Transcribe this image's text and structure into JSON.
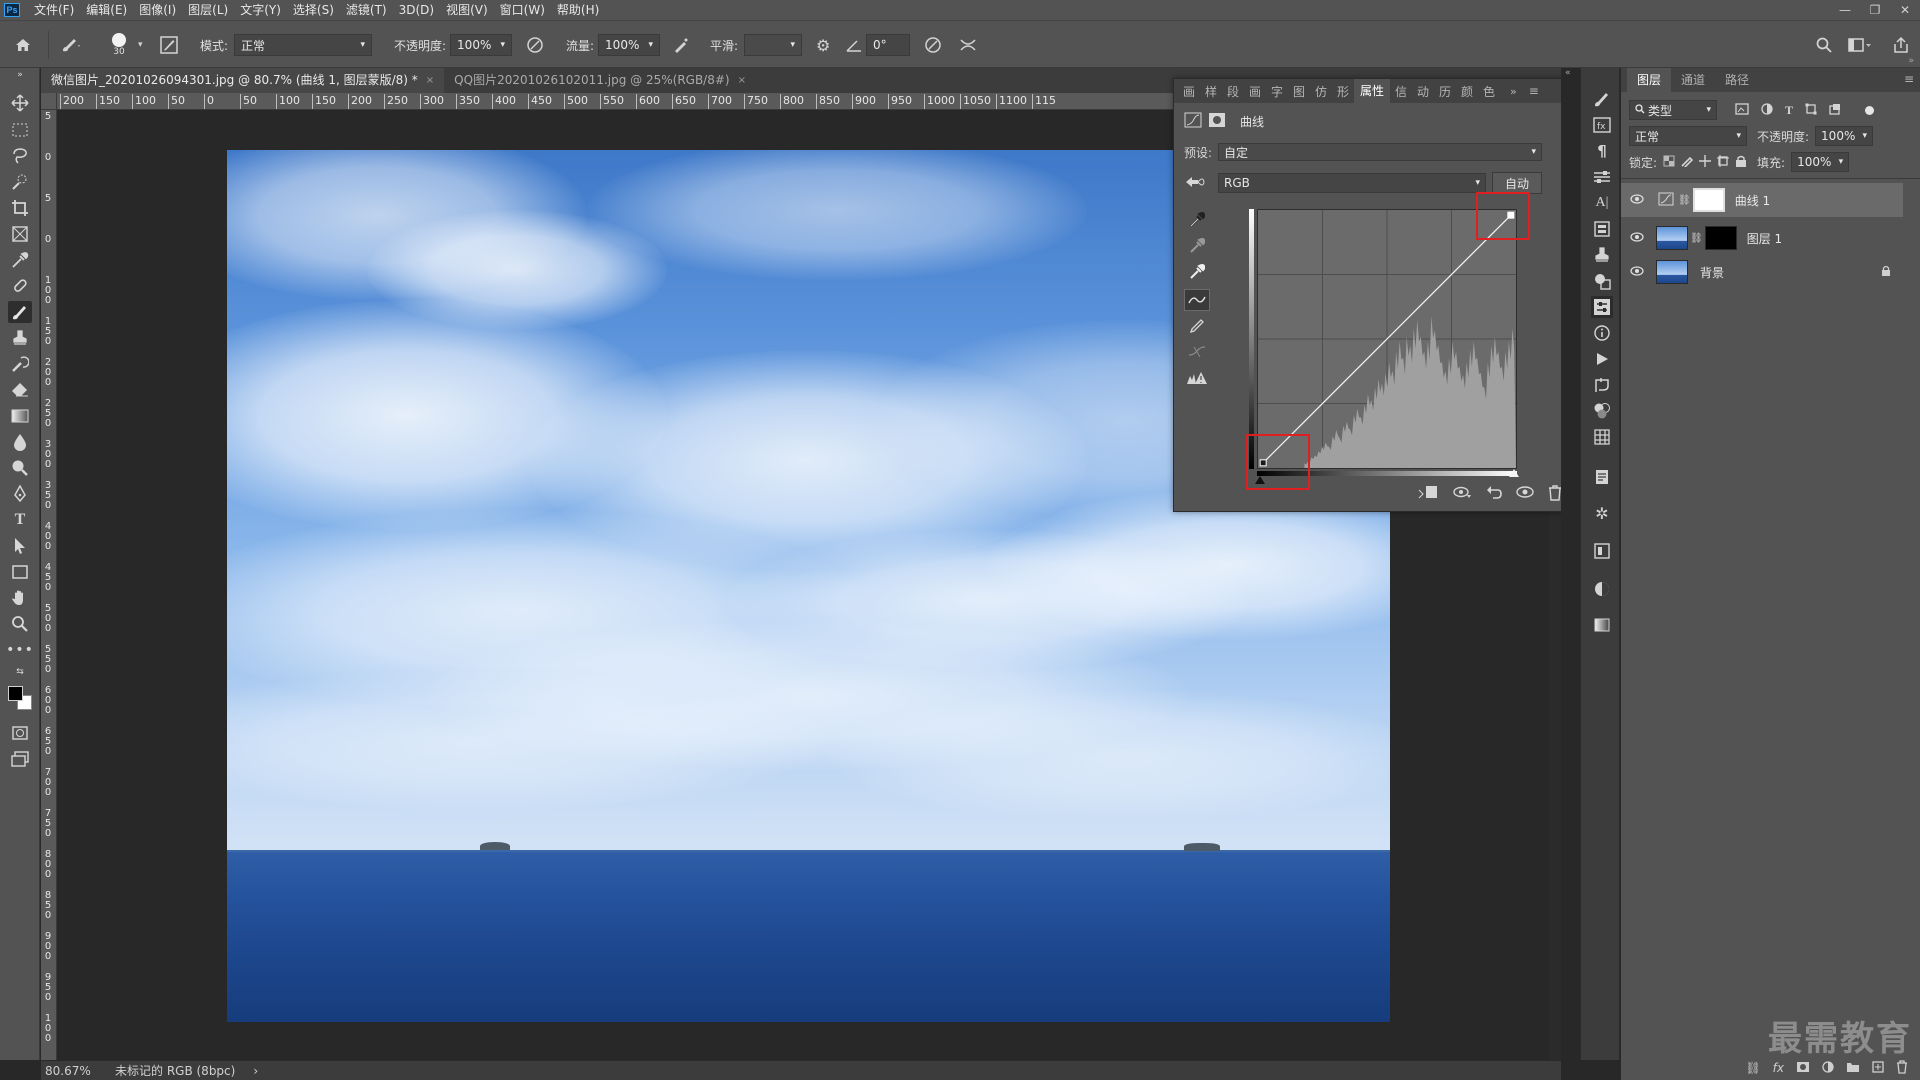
{
  "app": {
    "logo": "Ps"
  },
  "menu": [
    "文件(F)",
    "编辑(E)",
    "图像(I)",
    "图层(L)",
    "文字(Y)",
    "选择(S)",
    "滤镜(T)",
    "3D(D)",
    "视图(V)",
    "窗口(W)",
    "帮助(H)"
  ],
  "window_controls": {
    "minimize": "—",
    "restore": "❐",
    "close": "✕"
  },
  "options": {
    "brush_size": "30",
    "mode_label": "模式:",
    "mode_value": "正常",
    "opacity_label": "不透明度:",
    "opacity_value": "100%",
    "flow_label": "流量:",
    "flow_value": "100%",
    "smooth_label": "平滑:",
    "smooth_value": "",
    "angle_value": "0°"
  },
  "tabs": [
    {
      "label": "微信图片_20201026094301.jpg @ 80.7% (曲线 1, 图层蒙版/8) *",
      "close": "×"
    },
    {
      "label": "QQ图片20201026102011.jpg @ 25%(RGB/8#)",
      "close": "×"
    }
  ],
  "ruler_h": [
    "200",
    "150",
    "100",
    "50",
    "0",
    "50",
    "100",
    "150",
    "200",
    "250",
    "300",
    "350",
    "400",
    "450",
    "500",
    "550",
    "600",
    "650",
    "700",
    "750",
    "800",
    "850",
    "900",
    "950",
    "1000",
    "1050",
    "1100",
    "115"
  ],
  "ruler_v": [
    "5",
    "0",
    "5",
    "0",
    "1 0 0",
    "1 5 0",
    "2 0 0",
    "2 5 0",
    "3 0 0",
    "3 5 0",
    "4 0 0",
    "4 5 0",
    "5 0 0",
    "5 5 0",
    "6 0 0",
    "6 5 0",
    "7 0 0",
    "7 5 0",
    "8 0 0",
    "8 5 0",
    "9 0 0",
    "9 5 0",
    "1 0 0"
  ],
  "status": {
    "zoom": "80.67%",
    "profile": "未标记的 RGB (8bpc)",
    "arrow": "›"
  },
  "properties": {
    "tabs": [
      "画",
      "样",
      "段",
      "画",
      "字",
      "图",
      "仿",
      "形",
      "属性",
      "信",
      "动",
      "历",
      "颜",
      "色"
    ],
    "active_tab": "属性",
    "adjustment_title": "曲线",
    "preset_label": "预设:",
    "preset_value": "自定",
    "channel_value": "RGB",
    "auto_button": "自动",
    "curve_points": [
      [
        0.02,
        0.02
      ],
      [
        0.98,
        0.98
      ]
    ],
    "histogram": [
      0.02,
      0.03,
      0.05,
      0.06,
      0.08,
      0.1,
      0.12,
      0.1,
      0.15,
      0.18,
      0.14,
      0.2,
      0.22,
      0.18,
      0.25,
      0.28,
      0.24,
      0.3,
      0.35,
      0.32,
      0.38,
      0.42,
      0.4,
      0.45,
      0.5,
      0.46,
      0.55,
      0.6,
      0.52,
      0.62,
      0.58,
      0.66,
      0.7,
      0.62,
      0.55,
      0.6,
      0.72,
      0.65,
      0.58,
      0.5,
      0.46,
      0.52,
      0.6,
      0.55,
      0.48,
      0.44,
      0.5,
      0.56,
      0.6,
      0.52,
      0.45,
      0.38,
      0.5,
      0.58,
      0.62,
      0.55,
      0.48,
      0.55,
      0.6,
      0.66
    ]
  },
  "layers": {
    "tabs": [
      "图层",
      "通道",
      "路径"
    ],
    "filter_label": "类型",
    "blend_mode": "正常",
    "opacity_label": "不透明度:",
    "opacity_value": "100%",
    "lock_label": "锁定:",
    "fill_label": "填充:",
    "fill_value": "100%",
    "items": [
      {
        "name": "曲线 1",
        "selected": true
      },
      {
        "name": "图层 1",
        "selected": false
      },
      {
        "name": "背景",
        "selected": false
      }
    ]
  },
  "watermark": "最需教育",
  "colors": {
    "accent": "#31a8ff",
    "highlight": "#e02020"
  }
}
